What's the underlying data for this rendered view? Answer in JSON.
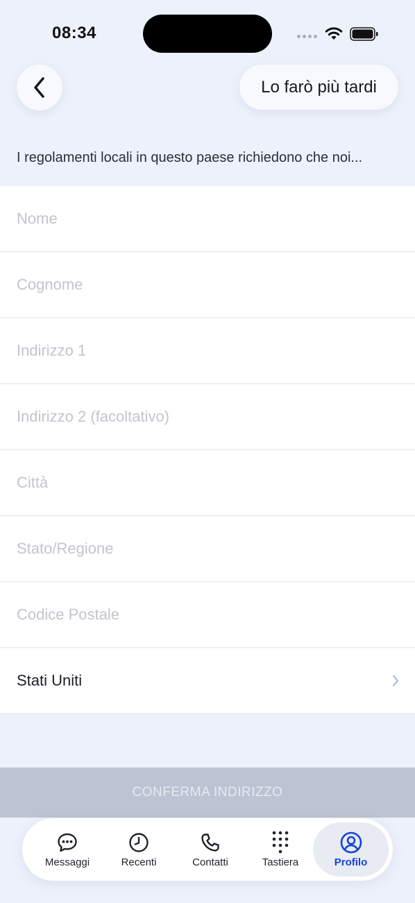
{
  "status": {
    "time": "08:34"
  },
  "header": {
    "back_icon": "chevron-left-icon",
    "later_label": "Lo farò più tardi"
  },
  "notice": "I regolamenti locali in questo paese richiedono che noi...",
  "form": {
    "first_name_placeholder": "Nome",
    "last_name_placeholder": "Cognome",
    "address1_placeholder": "Indirizzo 1",
    "address2_placeholder": "Indirizzo 2 (facoltativo)",
    "city_placeholder": "Città",
    "state_placeholder": "Stato/Regione",
    "postal_placeholder": "Codice Postale",
    "country_value": "Stati Uniti"
  },
  "confirm_label": "CONFERMA INDIRIZZO",
  "tabs": [
    {
      "label": "Messaggi",
      "icon": "chat-bubble-icon"
    },
    {
      "label": "Recenti",
      "icon": "clock-icon"
    },
    {
      "label": "Contatti",
      "icon": "phone-icon"
    },
    {
      "label": "Tastiera",
      "icon": "keypad-icon"
    },
    {
      "label": "Profilo",
      "icon": "user-circle-icon",
      "active": true
    }
  ],
  "colors": {
    "background": "#edf1fb",
    "accent": "#1543d6",
    "confirm_disabled": "#bcc3d2"
  }
}
